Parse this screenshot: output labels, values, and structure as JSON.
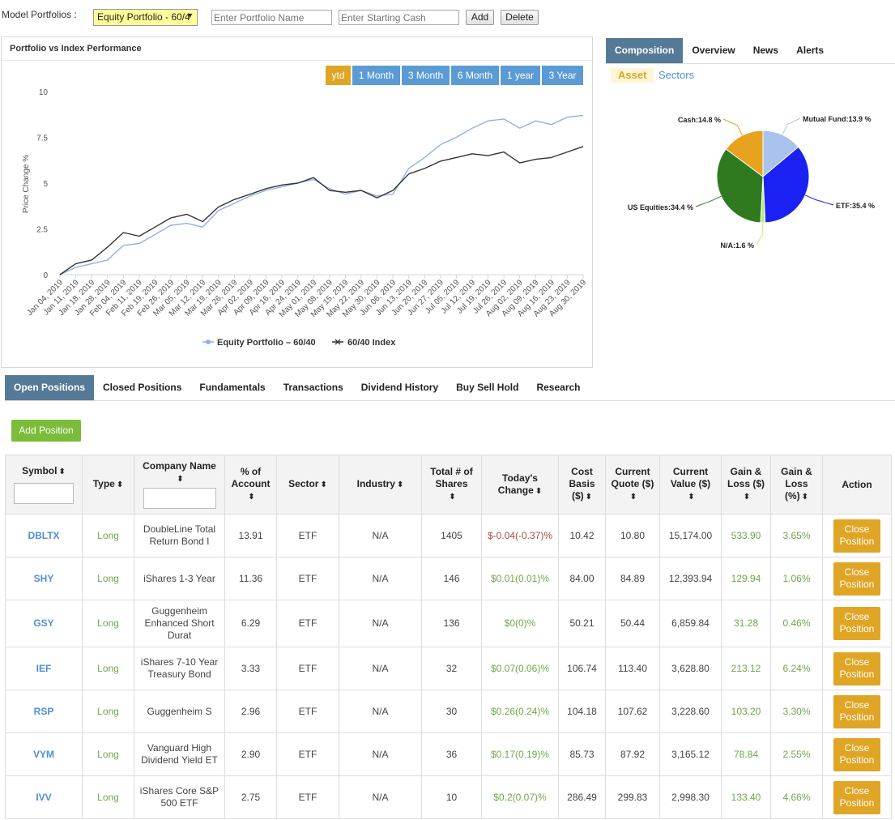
{
  "topbar": {
    "model_label": "Model Portfolios :",
    "selected_portfolio": "Equity Portfolio - 60/4",
    "name_placeholder": "Enter Portfolio Name",
    "cash_placeholder": "Enter Starting Cash",
    "add_label": "Add",
    "delete_label": "Delete"
  },
  "chart_panel": {
    "title": "Portfolio vs Index Performance",
    "ranges": [
      "ytd",
      "1 Month",
      "3 Month",
      "6 Month",
      "1 year",
      "3 Year"
    ],
    "active_range": "ytd"
  },
  "chart_data": {
    "type": "line",
    "title": "",
    "xlabel": "",
    "ylabel": "Price Change %",
    "ylim": [
      0,
      10
    ],
    "yticks": [
      0,
      2.5,
      5,
      7.5,
      10
    ],
    "grid": false,
    "legend_position": "bottom",
    "x": [
      "Jan 04, 2019",
      "Jan 11, 2019",
      "Jan 18, 2019",
      "Jan 28, 2019",
      "Feb 04, 2019",
      "Feb 11, 2019",
      "Feb 19, 2019",
      "Feb 26, 2019",
      "Mar 05, 2019",
      "Mar 12, 2019",
      "Mar 19, 2019",
      "Mar 26, 2019",
      "Apr 02, 2019",
      "Apr 09, 2019",
      "Apr 16, 2019",
      "Apr 24, 2019",
      "May 01, 2019",
      "May 08, 2019",
      "May 15, 2019",
      "May 22, 2019",
      "May 30, 2019",
      "Jun 06, 2019",
      "Jun 13, 2019",
      "Jun 20, 2019",
      "Jun 27, 2019",
      "Jul 05, 2019",
      "Jul 12, 2019",
      "Jul 19, 2019",
      "Jul 26, 2019",
      "Aug 02, 2019",
      "Aug 09, 2019",
      "Aug 16, 2019",
      "Aug 23, 2019",
      "Aug 30, 2019"
    ],
    "series": [
      {
        "name": "Equity Portfolio – 60/40",
        "color": "#8fb1e6",
        "values": [
          0.0,
          0.4,
          0.6,
          0.8,
          1.6,
          1.7,
          2.2,
          2.7,
          2.8,
          2.6,
          3.5,
          3.9,
          4.3,
          4.6,
          4.8,
          5.0,
          5.2,
          4.7,
          4.4,
          4.6,
          4.3,
          4.4,
          5.8,
          6.4,
          7.1,
          7.5,
          8.0,
          8.4,
          8.5,
          8.0,
          8.4,
          8.2,
          8.6,
          8.7
        ]
      },
      {
        "name": "60/40 Index",
        "color": "#333333",
        "values": [
          0.0,
          0.6,
          0.8,
          1.5,
          2.3,
          2.1,
          2.6,
          3.1,
          3.3,
          2.9,
          3.7,
          4.1,
          4.4,
          4.7,
          4.9,
          5.0,
          5.3,
          4.6,
          4.5,
          4.6,
          4.2,
          4.6,
          5.5,
          5.8,
          6.2,
          6.4,
          6.6,
          6.5,
          6.7,
          6.1,
          6.3,
          6.4,
          6.7,
          7.0
        ]
      }
    ]
  },
  "composition": {
    "tabs": [
      "Composition",
      "Overview",
      "News",
      "Alerts"
    ],
    "active_tab": "Composition",
    "sub_tabs": [
      "Asset",
      "Sectors"
    ],
    "active_sub_tab": "Asset",
    "pie": {
      "type": "pie",
      "slices": [
        {
          "label": "Mutual Fund:13.9 %",
          "value": 13.9,
          "color": "#a9c2ee"
        },
        {
          "label": "ETF:35.4 %",
          "value": 35.4,
          "color": "#1a21f2"
        },
        {
          "label": "N/A:1.6 %",
          "value": 1.6,
          "color": "#b9eb82"
        },
        {
          "label": "US Equities:34.4 %",
          "value": 34.4,
          "color": "#2f7a1f"
        },
        {
          "label": "Cash:14.8 %",
          "value": 14.8,
          "color": "#e7a31e"
        }
      ]
    }
  },
  "positions_tabs": {
    "tabs": [
      "Open Positions",
      "Closed Positions",
      "Fundamentals",
      "Transactions",
      "Dividend History",
      "Buy Sell Hold",
      "Research"
    ],
    "active": "Open Positions",
    "add_position_label": "Add Position"
  },
  "table": {
    "headers": {
      "symbol": "Symbol",
      "type": "Type",
      "company": "Company Name",
      "pct_account": "% of Account",
      "sector": "Sector",
      "industry": "Industry",
      "shares": "Total # of Shares",
      "today_change": "Today's Change",
      "cost_basis": "Cost Basis ($)",
      "current_quote": "Current Quote ($)",
      "current_value": "Current Value ($)",
      "gain_loss": "Gain & Loss ($)",
      "gain_loss_pct": "Gain & Loss (%)",
      "action": "Action"
    },
    "close_label": "Close Position",
    "rows": [
      {
        "symbol": "DBLTX",
        "type": "Long",
        "company": "DoubleLine Total Return Bond I",
        "pct": "13.91",
        "sector": "ETF",
        "industry": "N/A",
        "shares": "1405",
        "change": "$-0.04(-0.37)%",
        "change_dir": "neg",
        "cost": "10.42",
        "quote": "10.80",
        "value": "15,174.00",
        "gl": "533.90",
        "glp": "3.65%"
      },
      {
        "symbol": "SHY",
        "type": "Long",
        "company": "iShares 1-3 Year",
        "pct": "11.36",
        "sector": "ETF",
        "industry": "N/A",
        "shares": "146",
        "change": "$0.01(0.01)%",
        "change_dir": "pos",
        "cost": "84.00",
        "quote": "84.89",
        "value": "12,393.94",
        "gl": "129.94",
        "glp": "1.06%"
      },
      {
        "symbol": "GSY",
        "type": "Long",
        "company": "Guggenheim Enhanced Short Durat",
        "pct": "6.29",
        "sector": "ETF",
        "industry": "N/A",
        "shares": "136",
        "change": "$0(0)%",
        "change_dir": "pos",
        "cost": "50.21",
        "quote": "50.44",
        "value": "6,859.84",
        "gl": "31.28",
        "glp": "0.46%"
      },
      {
        "symbol": "IEF",
        "type": "Long",
        "company": "iShares 7-10 Year Treasury Bond",
        "pct": "3.33",
        "sector": "ETF",
        "industry": "N/A",
        "shares": "32",
        "change": "$0.07(0.06)%",
        "change_dir": "pos",
        "cost": "106.74",
        "quote": "113.40",
        "value": "3,628.80",
        "gl": "213.12",
        "glp": "6.24%"
      },
      {
        "symbol": "RSP",
        "type": "Long",
        "company": "Guggenheim S",
        "pct": "2.96",
        "sector": "ETF",
        "industry": "N/A",
        "shares": "30",
        "change": "$0.26(0.24)%",
        "change_dir": "pos",
        "cost": "104.18",
        "quote": "107.62",
        "value": "3,228.60",
        "gl": "103.20",
        "glp": "3.30%"
      },
      {
        "symbol": "VYM",
        "type": "Long",
        "company": "Vanguard High Dividend Yield ET",
        "pct": "2.90",
        "sector": "ETF",
        "industry": "N/A",
        "shares": "36",
        "change": "$0.17(0.19)%",
        "change_dir": "pos",
        "cost": "85.73",
        "quote": "87.92",
        "value": "3,165.12",
        "gl": "78.84",
        "glp": "2.55%"
      },
      {
        "symbol": "IVV",
        "type": "Long",
        "company": "iShares Core S&P 500 ETF",
        "pct": "2.75",
        "sector": "ETF",
        "industry": "N/A",
        "shares": "10",
        "change": "$0.2(0.07)%",
        "change_dir": "pos",
        "cost": "286.49",
        "quote": "299.83",
        "value": "2,998.30",
        "gl": "133.40",
        "glp": "4.66%"
      }
    ]
  }
}
